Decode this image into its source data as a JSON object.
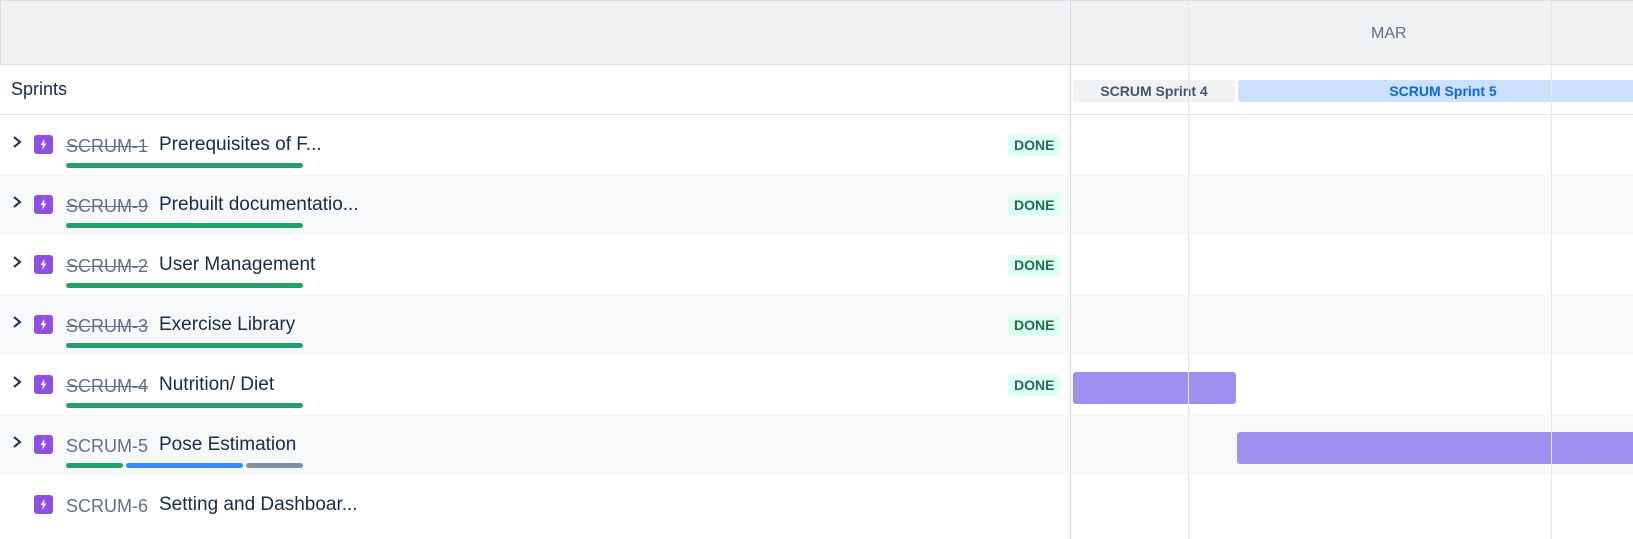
{
  "timeline": {
    "month": "MAR",
    "sprints_label": "Sprints",
    "sprints": [
      {
        "name": "SCRUM Sprint 4"
      },
      {
        "name": "SCRUM Sprint 5"
      }
    ]
  },
  "colors": {
    "epic_icon": "#904ee2",
    "done_badge_bg": "#dcfff1",
    "done_badge_text": "#216e4e",
    "progress_done": "#22a06b",
    "progress_inprogress": "#388bff",
    "progress_todo": "#8590a2",
    "timeline_bar": "#9f8fef"
  },
  "issues": [
    {
      "key": "SCRUM-1",
      "title": "Prerequisites of F...",
      "status": "DONE",
      "done": true,
      "expandable": true,
      "progress": {
        "done": 1.0,
        "in_progress": 0.0,
        "todo": 0.0
      }
    },
    {
      "key": "SCRUM-9",
      "title": "Prebuilt documentatio...",
      "status": "DONE",
      "done": true,
      "expandable": true,
      "progress": {
        "done": 1.0,
        "in_progress": 0.0,
        "todo": 0.0
      }
    },
    {
      "key": "SCRUM-2",
      "title": "User Management",
      "status": "DONE",
      "done": true,
      "expandable": true,
      "progress": {
        "done": 1.0,
        "in_progress": 0.0,
        "todo": 0.0
      }
    },
    {
      "key": "SCRUM-3",
      "title": "Exercise Library",
      "status": "DONE",
      "done": true,
      "expandable": true,
      "progress": {
        "done": 1.0,
        "in_progress": 0.0,
        "todo": 0.0
      }
    },
    {
      "key": "SCRUM-4",
      "title": "Nutrition/ Diet",
      "status": "DONE",
      "done": true,
      "expandable": true,
      "progress": {
        "done": 1.0,
        "in_progress": 0.0,
        "todo": 0.0
      }
    },
    {
      "key": "SCRUM-5",
      "title": "Pose Estimation",
      "status": "",
      "done": false,
      "expandable": true,
      "progress": {
        "done": 0.25,
        "in_progress": 0.5,
        "todo": 0.25
      }
    },
    {
      "key": "SCRUM-6",
      "title": "Setting and Dashboar...",
      "status": "",
      "done": false,
      "expandable": false,
      "progress": null
    }
  ]
}
